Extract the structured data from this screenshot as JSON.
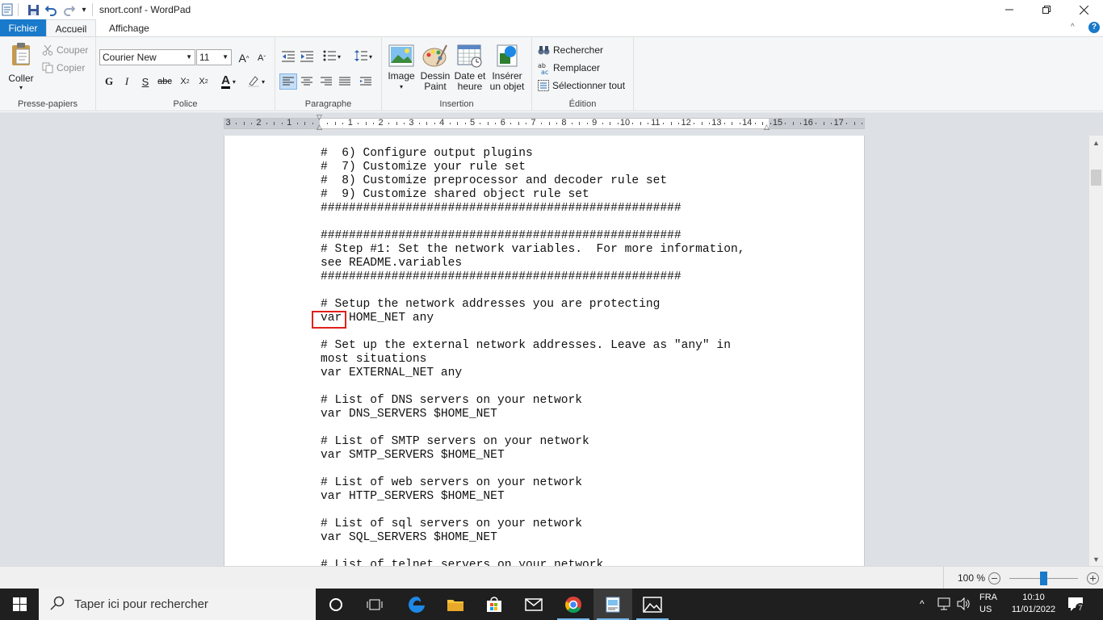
{
  "window": {
    "title": "snort.conf - WordPad"
  },
  "tabs": {
    "fichier": "Fichier",
    "accueil": "Accueil",
    "affichage": "Affichage"
  },
  "ribbon": {
    "clipboard": {
      "paste": "Coller",
      "cut": "Couper",
      "copy": "Copier",
      "label": "Presse-papiers"
    },
    "font": {
      "family": "Courier New",
      "size": "11",
      "bold": "G",
      "italic": "I",
      "underline": "S",
      "strike": "abc",
      "label": "Police"
    },
    "paragraph": {
      "label": "Paragraphe"
    },
    "insert": {
      "image_line1": "Image",
      "paint_line1": "Dessin",
      "paint_line2": "Paint",
      "datetime_line1": "Date et",
      "datetime_line2": "heure",
      "object_line1": "Insérer",
      "object_line2": "un objet",
      "label": "Insertion"
    },
    "edit": {
      "find": "Rechercher",
      "replace": "Remplacer",
      "select_all": "Sélectionner tout",
      "label": "Édition"
    }
  },
  "ruler": {
    "labels": [
      "3",
      "2",
      "1",
      "1",
      "2",
      "3",
      "4",
      "5",
      "6",
      "7",
      "8",
      "9",
      "10",
      "11",
      "12",
      "13",
      "14",
      "15",
      "16",
      "17"
    ]
  },
  "document": {
    "lines": [
      "#  6) Configure output plugins",
      "#  7) Customize your rule set",
      "#  8) Customize preprocessor and decoder rule set",
      "#  9) Customize shared object rule set",
      "###################################################",
      "",
      "###################################################",
      "# Step #1: Set the network variables.  For more information,",
      "see README.variables",
      "###################################################",
      "",
      "# Setup the network addresses you are protecting",
      "var HOME_NET any",
      "",
      "# Set up the external network addresses. Leave as \"any\" in",
      "most situations",
      "var EXTERNAL_NET any",
      "",
      "# List of DNS servers on your network",
      "var DNS_SERVERS $HOME_NET",
      "",
      "# List of SMTP servers on your network",
      "var SMTP_SERVERS $HOME_NET",
      "",
      "# List of web servers on your network",
      "var HTTP_SERVERS $HOME_NET",
      "",
      "# List of sql servers on your network",
      "var SQL_SERVERS $HOME_NET",
      "",
      "# List of telnet servers on your network"
    ]
  },
  "status": {
    "zoom": "100 %"
  },
  "taskbar": {
    "search_placeholder": "Taper ici pour rechercher",
    "lang_top": "FRA",
    "lang_bottom": "US",
    "time": "10:10",
    "date": "11/01/2022",
    "notif_count": "7"
  },
  "colors": {
    "accent": "#1979ca",
    "highlight_box": "#e0201b"
  }
}
